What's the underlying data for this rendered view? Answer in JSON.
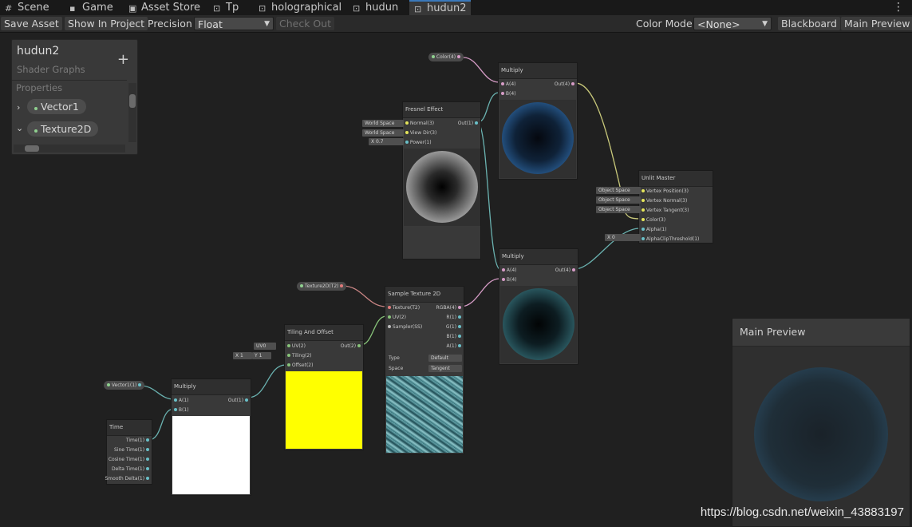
{
  "tabs": [
    {
      "label": "Scene",
      "icon": "grid-icon"
    },
    {
      "label": "Game",
      "icon": "gamepad-icon"
    },
    {
      "label": "Asset Store",
      "icon": "shopping-bag-icon"
    },
    {
      "label": "Tp",
      "icon": "tp-icon"
    },
    {
      "label": "holographical",
      "icon": "shader-graph-icon"
    },
    {
      "label": "hudun",
      "icon": "shader-graph-icon"
    },
    {
      "label": "hudun2",
      "icon": "shader-graph-icon"
    }
  ],
  "toolbar": {
    "save_asset": "Save Asset",
    "show_in_project": "Show In Project",
    "precision_label": "Precision",
    "precision_value": "Float",
    "check_out": "Check Out",
    "color_mode_label": "Color Mode",
    "color_mode_value": "<None>",
    "blackboard": "Blackboard",
    "main_preview": "Main Preview"
  },
  "blackboard": {
    "title": "hudun2",
    "subtitle": "Shader Graphs",
    "add_button": "+",
    "section": "Properties",
    "properties": [
      {
        "name": "Vector1",
        "expanded": false
      },
      {
        "name": "Texture2D",
        "expanded": true
      }
    ]
  },
  "nodes": {
    "color_prop": {
      "label": "Color(4)"
    },
    "multiply_top": {
      "title": "Multiply",
      "in_a": "A(4)",
      "in_b": "B(4)",
      "out": "Out(4)"
    },
    "fresnel": {
      "title": "Fresnel Effect",
      "in_normal": "Normal(3)",
      "in_view": "View Dir(3)",
      "in_power": "Power(1)",
      "out": "Out(1)",
      "chip_normal": "World Space",
      "chip_view": "World Space",
      "power_x": "X",
      "power_value": "0.7"
    },
    "unlit": {
      "title": "Unlit Master",
      "p1": "Vertex Position(3)",
      "p2": "Vertex Normal(3)",
      "p3": "Vertex Tangent(3)",
      "p4": "Color(3)",
      "p5": "Alpha(1)",
      "p6": "AlphaClipThreshold(1)",
      "chip1": "Object Space",
      "chip2": "Object Space",
      "chip3": "Object Space",
      "alpha_x": "X",
      "alpha_value": "0"
    },
    "multiply_mid": {
      "title": "Multiply",
      "in_a": "A(4)",
      "in_b": "B(4)",
      "out": "Out(4)"
    },
    "tex_prop": {
      "label": "Texture2D(T2)"
    },
    "sample_tex": {
      "title": "Sample Texture 2D",
      "in_tex": "Texture(T2)",
      "in_uv": "UV(2)",
      "in_sampler": "Sampler(SS)",
      "out_rgba": "RGBA(4)",
      "out_r": "R(1)",
      "out_g": "G(1)",
      "out_b": "B(1)",
      "out_a": "A(1)",
      "type_label": "Type",
      "type_value": "Default",
      "space_label": "Space",
      "space_value": "Tangent"
    },
    "tiling": {
      "title": "Tiling And Offset",
      "in_uv": "UV(2)",
      "in_tiling": "Tiling(2)",
      "in_offset": "Offset(2)",
      "out": "Out(2)",
      "uv_chip": "UV0",
      "tx": "X",
      "tx_val": "1",
      "ty": "Y",
      "ty_val": "1"
    },
    "vec_prop": {
      "label": "Vector1(1)"
    },
    "multiply_bot": {
      "title": "Multiply",
      "in_a": "A(1)",
      "in_b": "B(1)",
      "out": "Out(1)"
    },
    "time": {
      "title": "Time",
      "o1": "Time(1)",
      "o2": "Sine Time(1)",
      "o3": "Cosine Time(1)",
      "o4": "Delta Time(1)",
      "o5": "Smooth Delta(1)"
    }
  },
  "main_preview": {
    "title": "Main Preview"
  },
  "watermark": "https://blog.csdn.net/weixin_43883197",
  "colors": {
    "accent": "#3a79bb",
    "yellow_preview": "#ffff00",
    "white_preview": "#ffffff",
    "wire_teal": "#6ab2b0",
    "wire_pink": "#d69cc6",
    "wire_yellow": "#c8c87a"
  }
}
